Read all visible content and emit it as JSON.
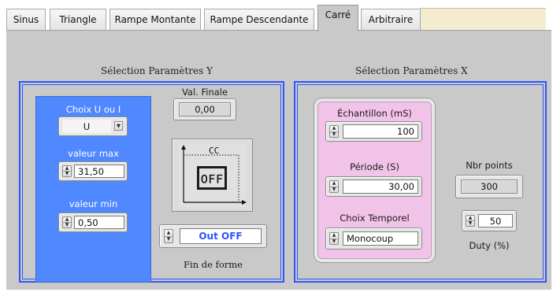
{
  "tabs": [
    {
      "label": "Sinus",
      "active": false
    },
    {
      "label": "Triangle",
      "active": false
    },
    {
      "label": "Rampe Montante",
      "active": false
    },
    {
      "label": "Rampe Descendante",
      "active": false
    },
    {
      "label": "Carré",
      "active": true
    },
    {
      "label": "Arbitraire",
      "active": false
    }
  ],
  "section_y": {
    "title": "Sélection Paramètres Y",
    "choix_label": "Choix U ou I",
    "choix_value": "U",
    "valeur_max_label": "valeur max",
    "valeur_max_value": "31,50",
    "valeur_min_label": "valeur min",
    "valeur_min_value": "0,50",
    "val_finale_label": "Val. Finale",
    "val_finale_value": "0,00",
    "graph_caption": "CC",
    "graph_screen_text": "OFF",
    "fin_value": "Out OFF",
    "fin_label": "Fin de forme"
  },
  "section_x": {
    "title": "Sélection Paramètres X",
    "echantillon_label": "Échantillon (mS)",
    "echantillon_value": "100",
    "periode_label": "Période (S)",
    "periode_value": "30,00",
    "choix_temporel_label": "Choix Temporel",
    "choix_temporel_value": "Monocoup",
    "nbr_points_label": "Nbr points",
    "nbr_points_value": "300",
    "duty_value": "50",
    "duty_label": "Duty (%)"
  },
  "colors": {
    "accent_blue": "#2d55ff",
    "blue_panel": "#4f88ff",
    "pink_panel": "#f2c3e8",
    "panel_gray": "#c9c9c9"
  }
}
